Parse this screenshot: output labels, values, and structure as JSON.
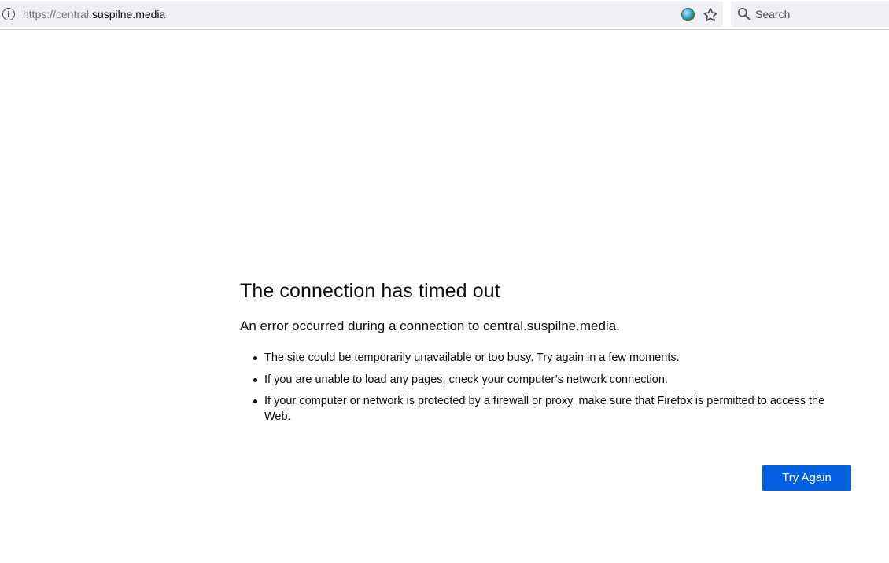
{
  "urlbar": {
    "url_prefix": "https://central.",
    "url_host": "suspilne.media",
    "info_icon": "info-icon",
    "site_icon": "globe-icon",
    "bookmark_icon": "star-icon"
  },
  "searchbar": {
    "placeholder": "Search",
    "icon": "search-icon"
  },
  "error": {
    "title": "The connection has timed out",
    "description": "An error occurred during a connection to central.suspilne.media.",
    "suggestions": [
      "The site could be temporarily unavailable or too busy. Try again in a few moments.",
      "If you are unable to load any pages, check your computer’s network connection.",
      "If your computer or network is protected by a firewall or proxy, make sure that Firefox is permitted to access the Web."
    ],
    "button_label": "Try Again"
  },
  "colors": {
    "accent": "#0060df",
    "urlbar_background": "#f0f0f4",
    "text": "#0c0c0d",
    "url_prefix": "#737373"
  }
}
